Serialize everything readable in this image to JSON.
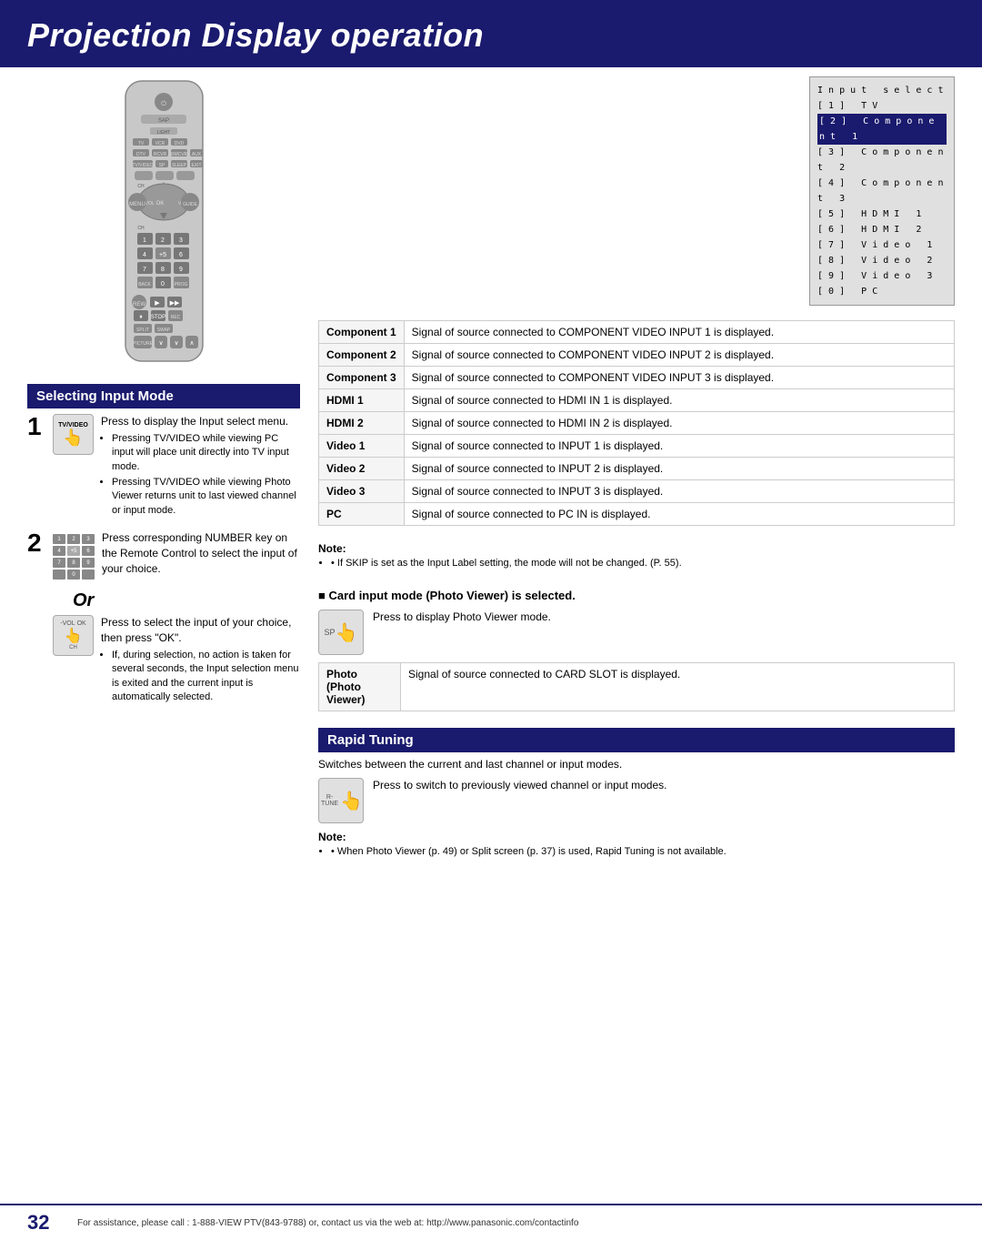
{
  "page": {
    "title": "Projection Display operation",
    "page_number": "32",
    "footer_text": "For assistance, please call : 1-888-VIEW PTV(843-9788) or, contact us via the web at: http://www.panasonic.com/contactinfo"
  },
  "input_select_menu": {
    "title": "Input select",
    "items": [
      {
        "num": "[1]",
        "label": "TV",
        "selected": false
      },
      {
        "num": "[2]",
        "label": "Component 1",
        "selected": true
      },
      {
        "num": "[3]",
        "label": "Component 2",
        "selected": false
      },
      {
        "num": "[4]",
        "label": "Component 3",
        "selected": false
      },
      {
        "num": "[5]",
        "label": "HDMI 1",
        "selected": false
      },
      {
        "num": "[6]",
        "label": "HDMI 2",
        "selected": false
      },
      {
        "num": "[7]",
        "label": "Video 1",
        "selected": false
      },
      {
        "num": "[8]",
        "label": "Video 2",
        "selected": false
      },
      {
        "num": "[9]",
        "label": "Video 3",
        "selected": false
      },
      {
        "num": "[0]",
        "label": "PC",
        "selected": false
      }
    ]
  },
  "input_table": {
    "rows": [
      {
        "input": "Component 1",
        "description": "Signal of source connected to COMPONENT VIDEO INPUT 1 is displayed."
      },
      {
        "input": "Component 2",
        "description": "Signal of source connected to COMPONENT VIDEO INPUT 2 is displayed."
      },
      {
        "input": "Component 3",
        "description": "Signal of source connected to COMPONENT VIDEO INPUT 3 is displayed."
      },
      {
        "input": "HDMI 1",
        "description": "Signal of source connected to HDMI IN 1 is displayed."
      },
      {
        "input": "HDMI 2",
        "description": "Signal of source connected to HDMI IN 2 is displayed."
      },
      {
        "input": "Video 1",
        "description": "Signal of source connected to INPUT 1 is displayed."
      },
      {
        "input": "Video 2",
        "description": "Signal of source connected to INPUT 2 is displayed."
      },
      {
        "input": "Video 3",
        "description": "Signal of source connected to INPUT 3 is displayed."
      },
      {
        "input": "PC",
        "description": "Signal of source connected to PC IN is displayed."
      }
    ]
  },
  "note_input": {
    "label": "Note:",
    "text": "• If SKIP is set as the Input Label setting, the mode will not be changed. (P. 55)."
  },
  "selecting_section": {
    "title": "Selecting Input Mode",
    "step1": {
      "number": "1",
      "button_label": "TV/VIDEO",
      "main_text": "Press to display the Input select menu.",
      "bullets": [
        "Pressing TV/VIDEO while viewing PC input will place unit directly into TV input mode.",
        "Pressing TV/VIDEO while viewing Photo Viewer returns unit to last viewed channel or input mode."
      ]
    },
    "step2": {
      "number": "2",
      "main_text": "Press corresponding NUMBER key on the Remote Control to select the input of your choice.",
      "num_grid": [
        "1",
        "2",
        "3",
        "4",
        "+5",
        "6",
        "7",
        "8",
        "9",
        "",
        "0",
        ""
      ]
    },
    "or_text": "Or",
    "step3": {
      "main_text": "Press to select the input of your choice, then press \"OK\".",
      "bullets": [
        "If, during selection, no action is taken for several seconds, the Input selection menu is exited and the current input is automatically selected."
      ]
    }
  },
  "card_section": {
    "title": "Card input mode (Photo Viewer) is selected.",
    "step_text": "Press to display Photo Viewer mode.",
    "photo_table": {
      "input": "Photo (Photo Viewer)",
      "description": "Signal of source connected to CARD SLOT is displayed."
    }
  },
  "rapid_section": {
    "title": "Rapid Tuning",
    "description": "Switches between the current and last channel or input modes.",
    "button_label": "R-TUNE",
    "step_text": "Press to switch to previously viewed channel or input modes.",
    "note_label": "Note:",
    "note_text": "• When Photo Viewer (p. 49) or Split screen (p. 37) is used, Rapid Tuning is not available."
  }
}
